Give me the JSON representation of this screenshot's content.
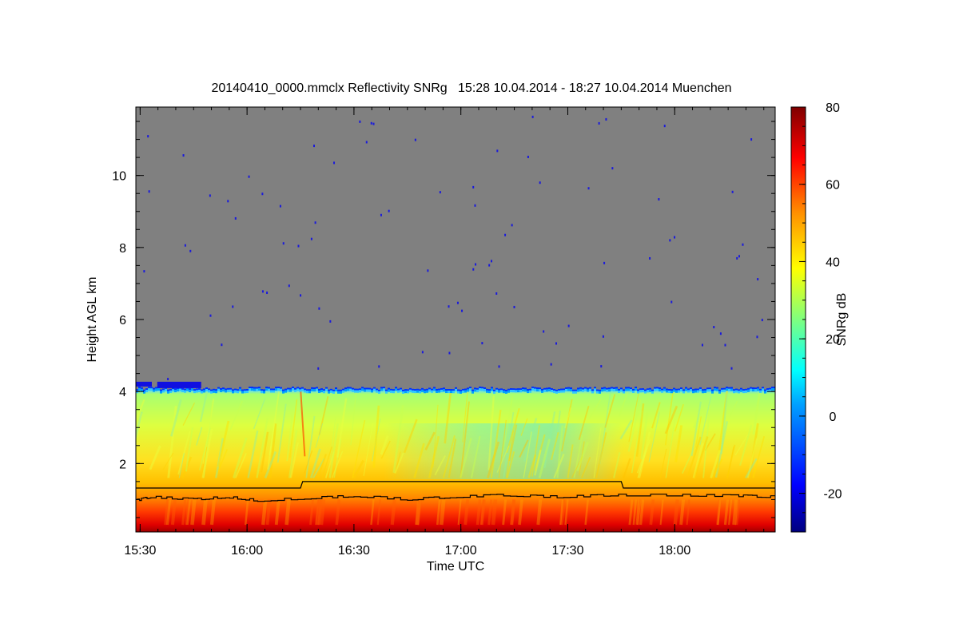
{
  "chart_data": {
    "type": "heatmap",
    "title": "20140410_0000.mmclx Reflectivity SNRg   15:28 10.04.2014 - 18:27 10.04.2014 Muenchen",
    "xlabel": "Time UTC",
    "ylabel": "Height AGL km",
    "colorbar_label": "SNRg dB",
    "xlim_hours": [
      15.48,
      18.47
    ],
    "ylim_km": [
      0.1,
      11.9
    ],
    "x_ticks": [
      {
        "value": 15.5,
        "label": "15:30"
      },
      {
        "value": 16.0,
        "label": "16:00"
      },
      {
        "value": 16.5,
        "label": "16:30"
      },
      {
        "value": 17.0,
        "label": "17:00"
      },
      {
        "value": 17.5,
        "label": "17:30"
      },
      {
        "value": 18.0,
        "label": "18:00"
      }
    ],
    "y_ticks": [
      {
        "value": 2,
        "label": "2"
      },
      {
        "value": 4,
        "label": "4"
      },
      {
        "value": 6,
        "label": "6"
      },
      {
        "value": 8,
        "label": "8"
      },
      {
        "value": 10,
        "label": "10"
      }
    ],
    "colorbar_range": [
      -30,
      80
    ],
    "colorbar_ticks": [
      {
        "value": -20,
        "label": "-20"
      },
      {
        "value": 0,
        "label": "0"
      },
      {
        "value": 20,
        "label": "20"
      },
      {
        "value": 40,
        "label": "40"
      },
      {
        "value": 60,
        "label": "60"
      },
      {
        "value": 80,
        "label": "80"
      }
    ],
    "background_color": "#808080",
    "echo_top_km": 4.05,
    "snr_profile_dB": [
      {
        "height_km": 0.25,
        "snr": 72
      },
      {
        "height_km": 0.6,
        "snr": 62
      },
      {
        "height_km": 1.0,
        "snr": 55
      },
      {
        "height_km": 1.5,
        "snr": 47
      },
      {
        "height_km": 2.5,
        "snr": 38
      },
      {
        "height_km": 3.5,
        "snr": 32
      },
      {
        "height_km": 4.0,
        "snr": 12
      }
    ],
    "upper_boundary_line": [
      {
        "t": 15.48,
        "h": 1.32
      },
      {
        "t": 16.25,
        "h": 1.32
      },
      {
        "t": 16.26,
        "h": 1.5
      },
      {
        "t": 17.75,
        "h": 1.5
      },
      {
        "t": 17.76,
        "h": 1.32
      },
      {
        "t": 18.47,
        "h": 1.32
      }
    ],
    "lower_boundary_line": [
      {
        "t": 15.48,
        "h": 0.95
      },
      {
        "t": 15.55,
        "h": 1.05
      },
      {
        "t": 15.75,
        "h": 0.98
      },
      {
        "t": 15.9,
        "h": 1.05
      },
      {
        "t": 16.05,
        "h": 0.95
      },
      {
        "t": 16.3,
        "h": 1.02
      },
      {
        "t": 16.5,
        "h": 1.08
      },
      {
        "t": 16.75,
        "h": 0.98
      },
      {
        "t": 16.95,
        "h": 1.05
      },
      {
        "t": 17.2,
        "h": 1.1
      },
      {
        "t": 17.45,
        "h": 1.05
      },
      {
        "t": 17.7,
        "h": 1.1
      },
      {
        "t": 18.0,
        "h": 1.1
      },
      {
        "t": 18.3,
        "h": 1.08
      },
      {
        "t": 18.47,
        "h": 1.05
      }
    ]
  }
}
